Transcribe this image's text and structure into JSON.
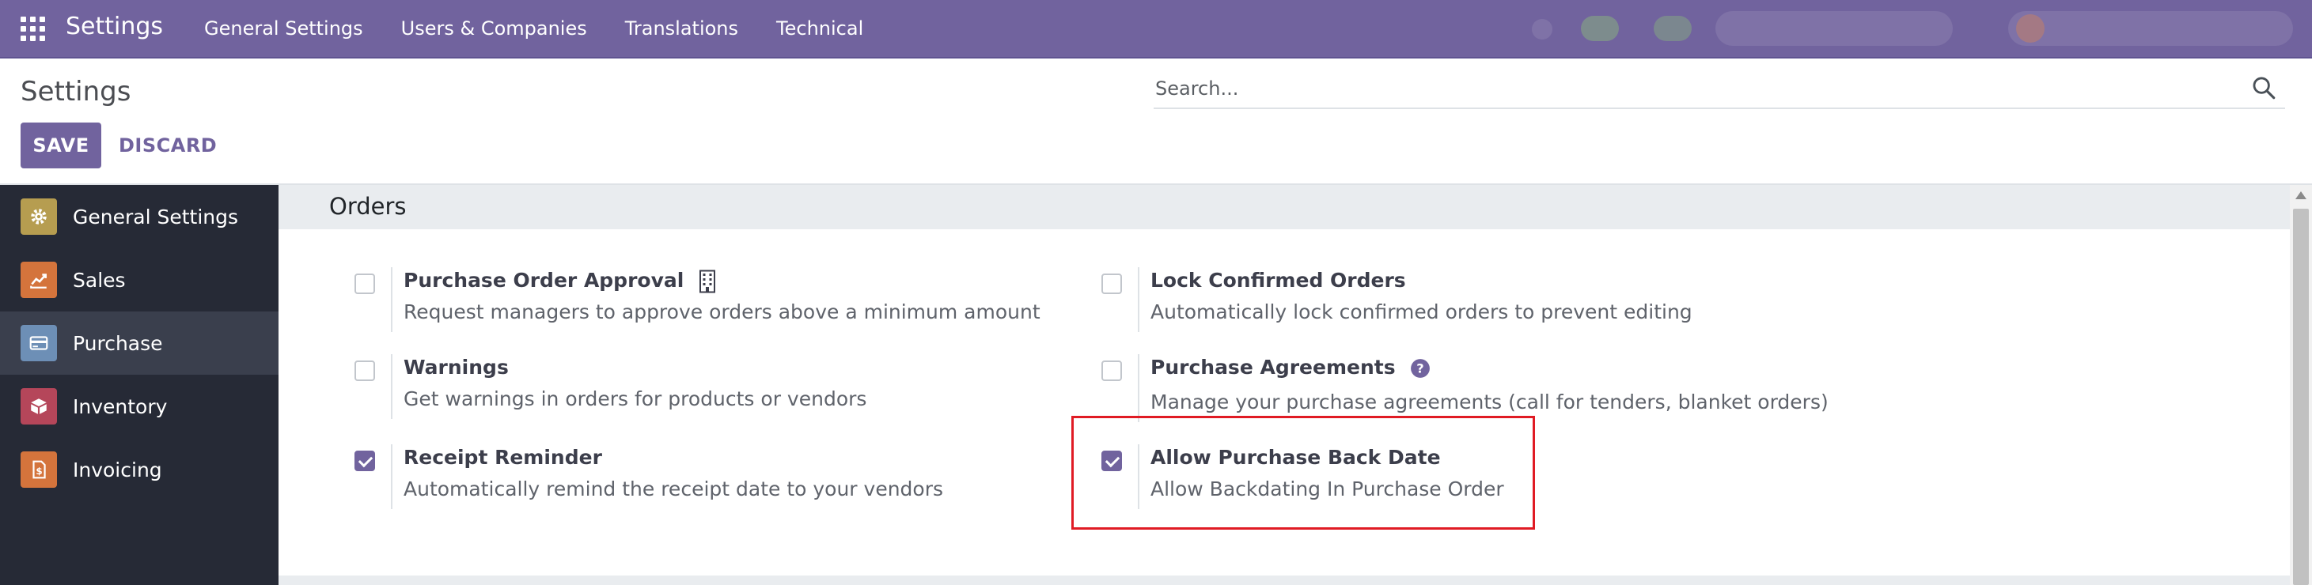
{
  "navbar": {
    "app_title": "Settings",
    "menu": [
      "General Settings",
      "Users & Companies",
      "Translations",
      "Technical"
    ],
    "color": "#71639e"
  },
  "control_panel": {
    "title": "Settings",
    "search_placeholder": "Search...",
    "save_label": "SAVE",
    "discard_label": "DISCARD"
  },
  "sidebar": {
    "items": [
      {
        "label": "General Settings",
        "icon": "gear-icon",
        "color": "#b69d50"
      },
      {
        "label": "Sales",
        "icon": "chart-icon",
        "color": "#d4743c"
      },
      {
        "label": "Purchase",
        "icon": "credit-card-icon",
        "color": "#6d8fb6"
      },
      {
        "label": "Inventory",
        "icon": "box-icon",
        "color": "#b5465a"
      },
      {
        "label": "Invoicing",
        "icon": "invoice-icon",
        "color": "#d4743c"
      }
    ],
    "active": "Purchase"
  },
  "section": {
    "title": "Orders",
    "settings": [
      {
        "title": "Purchase Order Approval",
        "description": "Request managers to approve orders above a minimum amount",
        "checked": false,
        "icon": "building-icon"
      },
      {
        "title": "Lock Confirmed Orders",
        "description": "Automatically lock confirmed orders to prevent editing",
        "checked": false
      },
      {
        "title": "Warnings",
        "description": "Get warnings in orders for products or vendors",
        "checked": false
      },
      {
        "title": "Purchase Agreements",
        "description": "Manage your purchase agreements (call for tenders, blanket orders)",
        "checked": false,
        "icon": "help-icon"
      },
      {
        "title": "Receipt Reminder",
        "description": "Automatically remind the receipt date to your vendors",
        "checked": true
      },
      {
        "title": "Allow Purchase Back Date",
        "description": "Allow Backdating In Purchase Order",
        "checked": true,
        "highlighted": true
      }
    ]
  },
  "colors": {
    "accent": "#71639e",
    "highlight": "#e01b24",
    "sidebar_bg": "#262a36"
  }
}
